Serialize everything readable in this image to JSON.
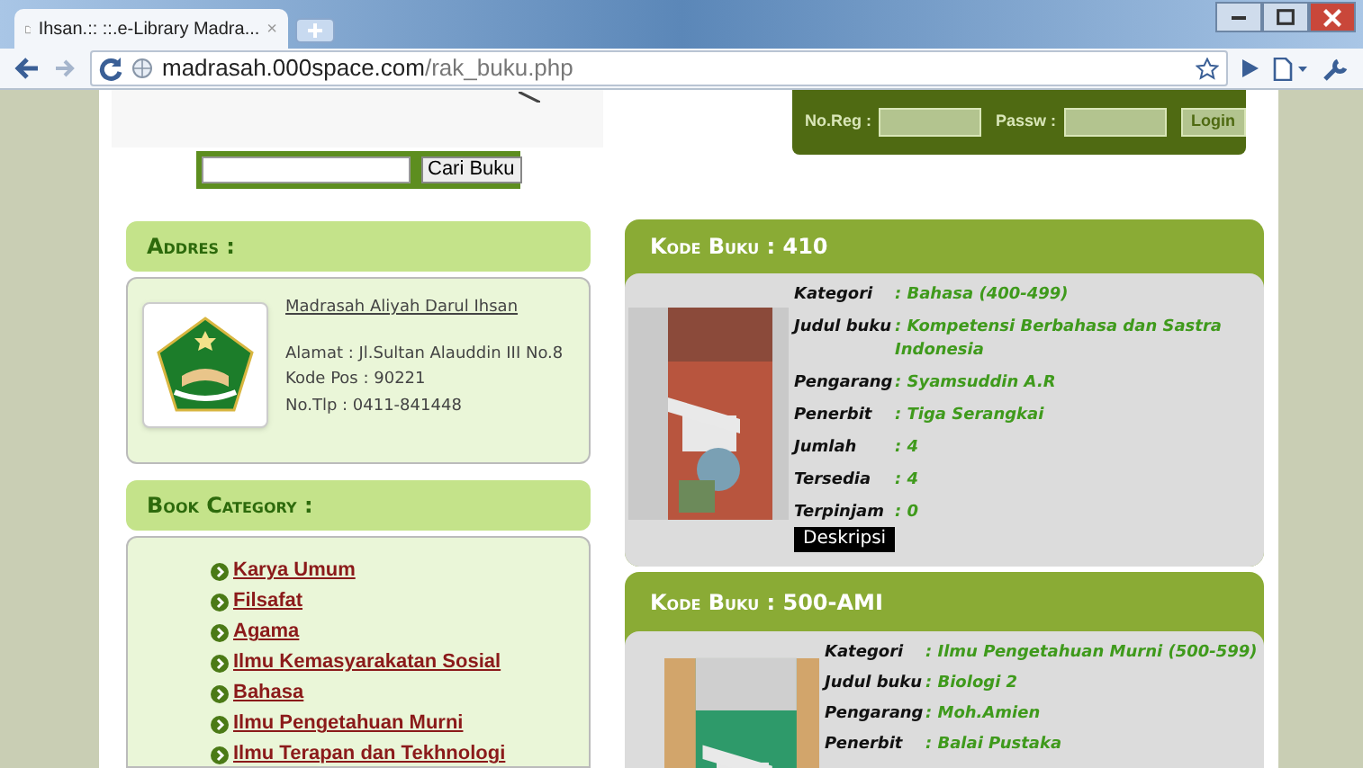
{
  "browser": {
    "tab": {
      "title": "Ihsan.:: ::.e-Library Madra...",
      "close": "×"
    },
    "url_host": "madrasah.000space.com",
    "url_path": "/rak_buku.php"
  },
  "search": {
    "button": "Cari Buku"
  },
  "login": {
    "reg_label": "No.Reg :",
    "pass_label": "Passw :",
    "button": "Login"
  },
  "address": {
    "heading": "Addres :",
    "name": "Madrasah Aliyah Darul Ihsan",
    "lines": [
      "Alamat : Jl.Sultan Alauddin III No.8",
      "Kode Pos : 90221",
      "No.Tlp : 0411-841448"
    ]
  },
  "categories": {
    "heading": "Book Category :",
    "items": [
      "Karya Umum",
      "Filsafat",
      "Agama",
      "Ilmu Kemasyarakatan Sosial",
      "Bahasa",
      "Ilmu Pengetahuan Murni",
      "Ilmu Terapan dan Tekhnologi"
    ]
  },
  "books": [
    {
      "heading": "Kode Buku : 410",
      "fields": [
        {
          "label": "Kategori",
          "value": ": Bahasa (400-499)"
        },
        {
          "label": "Judul buku",
          "value": ": Kompetensi Berbahasa dan Sastra Indonesia"
        },
        {
          "label": "Pengarang",
          "value": ": Syamsuddin A.R"
        },
        {
          "label": "Penerbit",
          "value": ": Tiga Serangkai"
        },
        {
          "label": "Jumlah",
          "value": ": 4"
        },
        {
          "label": "Tersedia",
          "value": ": 4"
        },
        {
          "label": "Terpinjam",
          "value": ": 0"
        }
      ],
      "button": "Deskripsi"
    },
    {
      "heading": "Kode Buku : 500-AMI",
      "fields": [
        {
          "label": "Kategori",
          "value": ": Ilmu Pengetahuan Murni (500-599)"
        },
        {
          "label": "Judul buku",
          "value": ": Biologi 2"
        },
        {
          "label": "Pengarang",
          "value": ": Moh.Amien"
        },
        {
          "label": "Penerbit",
          "value": ": Balai Pustaka"
        }
      ]
    }
  ]
}
